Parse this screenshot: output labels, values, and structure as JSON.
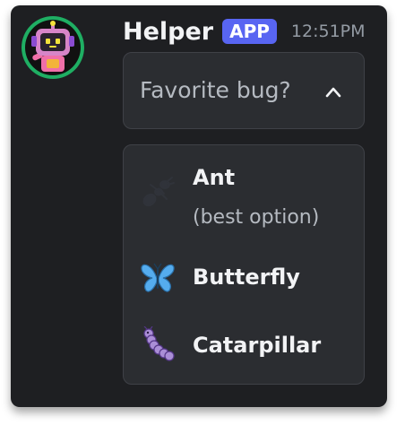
{
  "message": {
    "author": "Helper",
    "badge": "APP",
    "timestamp": "12:51PM"
  },
  "select": {
    "placeholder": "Favorite bug?",
    "expanded": true
  },
  "options": [
    {
      "label": "Ant",
      "description": "(best option)",
      "icon": "ant-icon"
    },
    {
      "label": "Butterfly",
      "description": "",
      "icon": "butterfly-icon"
    },
    {
      "label": "Catarpillar",
      "description": "",
      "icon": "caterpillar-icon"
    }
  ],
  "colors": {
    "background": "#1e1f22",
    "panel": "#2b2d31",
    "badge": "#5865f2",
    "text": "#f2f3f5",
    "muted": "#b5bac1"
  }
}
